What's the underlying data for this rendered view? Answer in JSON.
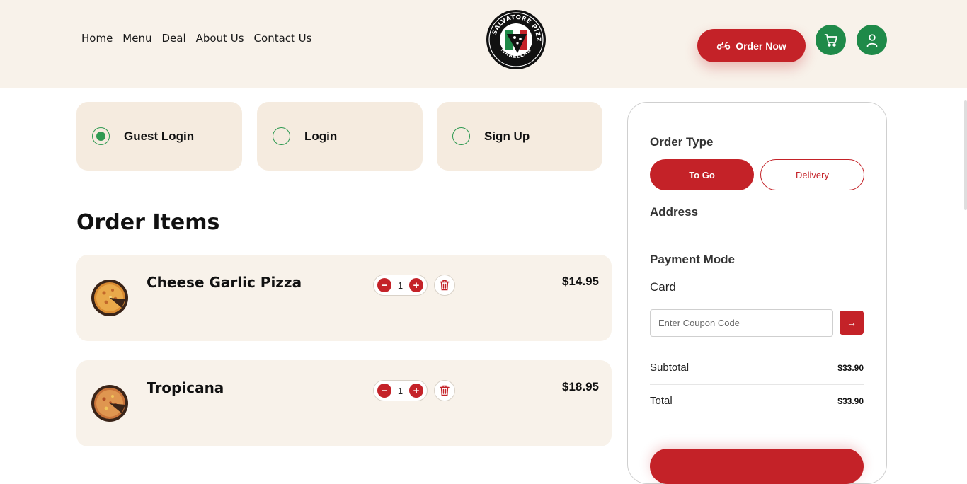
{
  "header": {
    "nav": [
      "Home",
      "Menu",
      "Deal",
      "About Us",
      "Contact Us"
    ],
    "logo_text": [
      "LA SALVATORE PIZZA",
      "MARELLAN"
    ],
    "order_now_label": "Order Now",
    "icons": {
      "cart": "cart-icon",
      "user": "user-icon",
      "scooter": "scooter-icon"
    }
  },
  "login_options": [
    {
      "label": "Guest Login",
      "selected": true
    },
    {
      "label": "Login",
      "selected": false
    },
    {
      "label": "Sign Up",
      "selected": false
    }
  ],
  "order_items_title": "Order Items",
  "items": [
    {
      "name": "Cheese Garlic Pizza",
      "quantity": "1",
      "price": "$14.95"
    },
    {
      "name": "Tropicana",
      "quantity": "1",
      "price": "$18.95"
    }
  ],
  "summary": {
    "order_type_label": "Order Type",
    "order_types": [
      "To Go",
      "Delivery"
    ],
    "selected_order_type": "To Go",
    "address_label": "Address",
    "payment_mode_label": "Payment Mode",
    "payment_mode_value": "Card",
    "coupon_placeholder": "Enter Coupon Code",
    "subtotal_label": "Subtotal",
    "subtotal_value": "$33.90",
    "total_label": "Total",
    "total_value": "$33.90"
  },
  "colors": {
    "brand_red": "#c42228",
    "brand_green": "#1f8a49",
    "cream": "#f8f2ea",
    "card_cream": "#f5ebdf"
  }
}
